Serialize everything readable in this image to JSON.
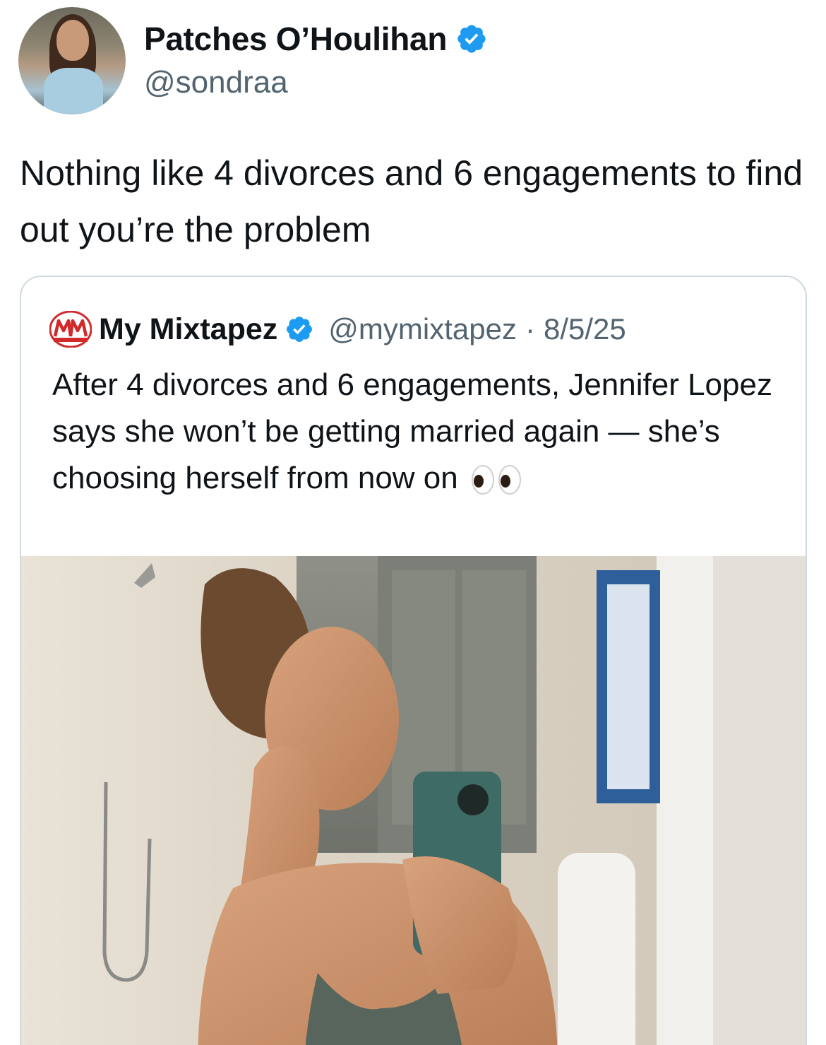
{
  "author": {
    "display_name": "Patches O’Houlihan",
    "handle": "@sondraa",
    "verified": true,
    "avatar_icon": "profile-photo"
  },
  "tweet": {
    "text": "Nothing like 4 divorces and 6 engagements to find out you’re the problem"
  },
  "quoted_tweet": {
    "display_name": "My Mixtapez",
    "handle": "@mymixtapez",
    "separator": "·",
    "date": "8/5/25",
    "verified": true,
    "logo_icon": "mm-logo-icon",
    "text": "After 4 divorces and 6 engagements, Jennifer Lopez says she won’t be getting married again — she’s choosing herself from now on",
    "emoji": "eyes-emoji",
    "media_icon": "mirror-selfie-photo"
  },
  "colors": {
    "verified_blue": "#1d9bf0",
    "secondary_text": "#536471",
    "border": "#cfd9de",
    "mm_red": "#d22a2a"
  }
}
